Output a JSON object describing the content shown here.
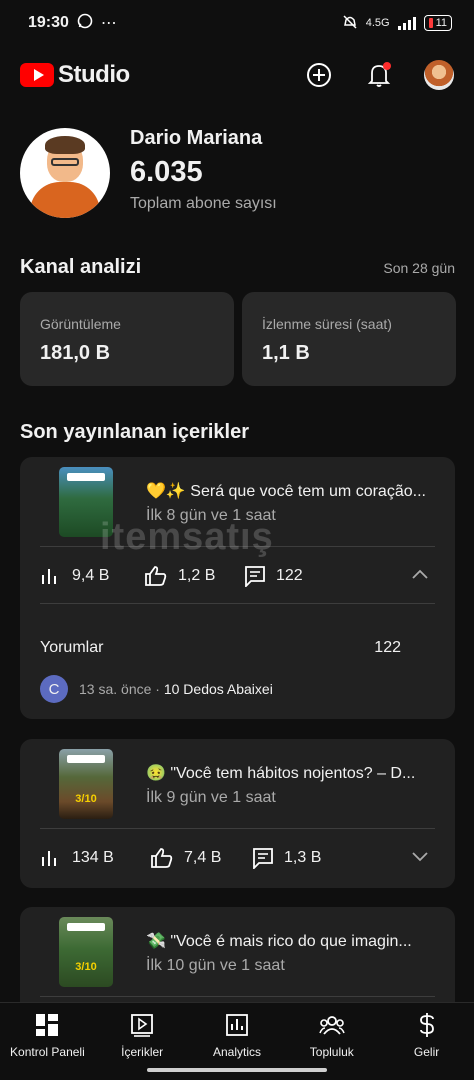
{
  "status_bar": {
    "time": "19:30",
    "network": "4.5G",
    "battery": "11"
  },
  "header": {
    "brand": "Studio"
  },
  "channel": {
    "name": "Dario Mariana",
    "subscribers": "6.035",
    "subscribers_label": "Toplam abone sayısı"
  },
  "analytics": {
    "title": "Kanal analizi",
    "range": "Son 28 gün",
    "cards": [
      {
        "label": "Görüntüleme",
        "value": "181,0 B"
      },
      {
        "label": "İzlenme süresi (saat)",
        "value": "1,1 B"
      }
    ]
  },
  "recent": {
    "title": "Son yayınlanan içerikler",
    "items": [
      {
        "title": "💛✨ Será que você tem um coração...",
        "age": "İlk 8 gün ve 1 saat",
        "views": "9,4 B",
        "likes": "1,2 B",
        "comments": "122",
        "thumb_mark": "",
        "expanded": true,
        "comments_label": "Yorumlar",
        "comments_count": "122",
        "latest_comment": {
          "initial": "C",
          "time": "13 sa. önce",
          "author": "10 Dedos Abaixei"
        }
      },
      {
        "title": "🤢 \"Você tem hábitos nojentos? – D...",
        "age": "İlk 9 gün ve 1 saat",
        "views": "134 B",
        "likes": "7,4 B",
        "comments": "1,3 B",
        "thumb_mark": "3/10"
      },
      {
        "title": "💸 \"Você é mais rico do que imagin...",
        "age": "İlk 10 gün ve 1 saat",
        "thumb_mark": "3/10"
      }
    ]
  },
  "watermark": "itemsatış",
  "bottom_nav": [
    {
      "label": "Kontrol Paneli",
      "icon": "dashboard-icon"
    },
    {
      "label": "İçerikler",
      "icon": "content-icon"
    },
    {
      "label": "Analytics",
      "icon": "analytics-icon"
    },
    {
      "label": "Topluluk",
      "icon": "community-icon"
    },
    {
      "label": "Gelir",
      "icon": "earn-icon"
    }
  ],
  "colors": {
    "accent": "#ff0000",
    "background": "#0f0f0f",
    "card": "#212121",
    "stat_card": "#282828"
  }
}
